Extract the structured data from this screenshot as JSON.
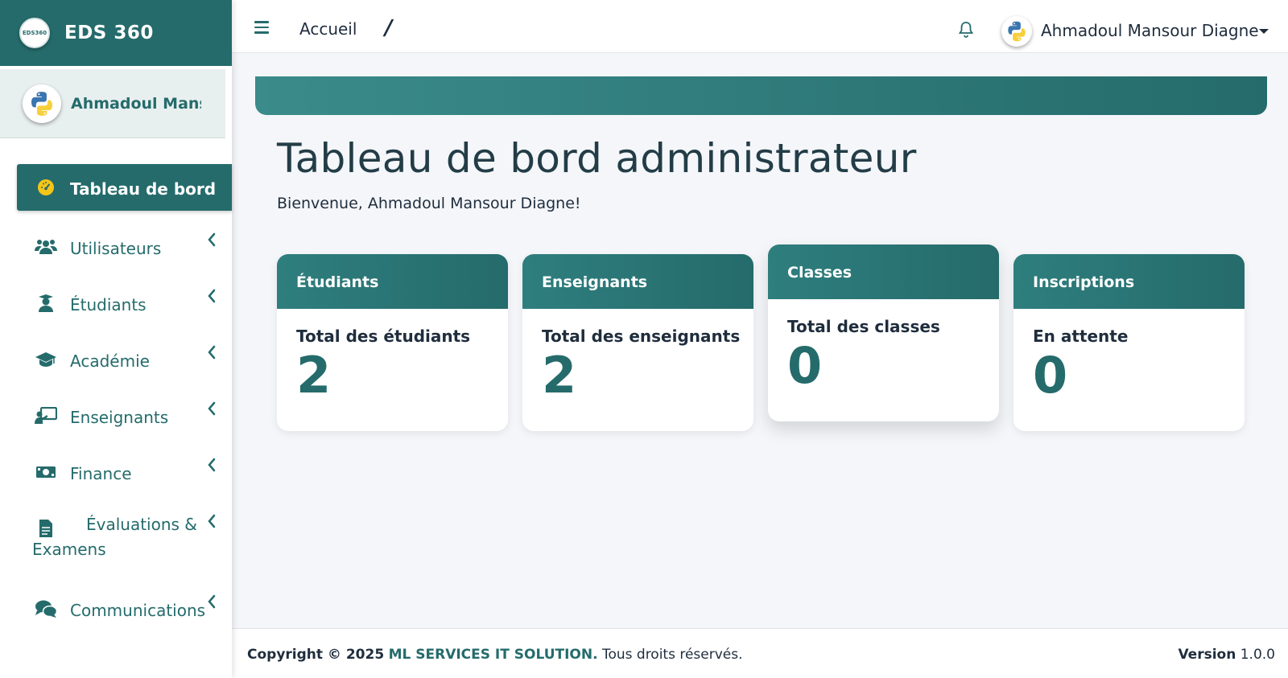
{
  "sidebar": {
    "brand_logo_text": "EDS360",
    "brand_name": "EDS 360",
    "user_name": "Ahmadoul Mansour Diagne",
    "menu": [
      {
        "label": "Tableau de bord",
        "icon": "tachometer-icon",
        "active": true
      },
      {
        "label": "Utilisateurs",
        "icon": "users-icon"
      },
      {
        "label": "Étudiants",
        "icon": "student-icon"
      },
      {
        "label": "Académie",
        "icon": "graduation-cap-icon"
      },
      {
        "label": "Enseignants",
        "icon": "teacher-icon"
      },
      {
        "label": "Finance",
        "icon": "money-icon"
      },
      {
        "label_line1": "Évaluations &",
        "label_line2": "Examens",
        "icon": "file-icon"
      },
      {
        "label": "Communications",
        "icon": "comments-icon"
      }
    ]
  },
  "header": {
    "breadcrumb": "Accueil",
    "breadcrumb_separator": "/",
    "user_name": "Ahmadoul Mansour Diagne"
  },
  "main": {
    "title": "Tableau de bord administrateur",
    "welcome": "Bienvenue, Ahmadoul Mansour Diagne!",
    "cards": [
      {
        "title": "Étudiants",
        "label": "Total des étudiants",
        "value": "2"
      },
      {
        "title": "Enseignants",
        "label": "Total des enseignants",
        "value": "2"
      },
      {
        "title": "Classes",
        "label": "Total des classes",
        "value": "0"
      },
      {
        "title": "Inscriptions",
        "label": "En attente",
        "value": "0"
      }
    ]
  },
  "footer": {
    "copyright_prefix": "Copyright © 2025",
    "company": "ML SERVICES IT SOLUTION.",
    "rights": "Tous droits réservés.",
    "version_label": "Version",
    "version": "1.0.0"
  },
  "colors": {
    "primary": "#256b6b",
    "primary_light": "#3b8b8b",
    "active_icon": "#f5c518"
  }
}
